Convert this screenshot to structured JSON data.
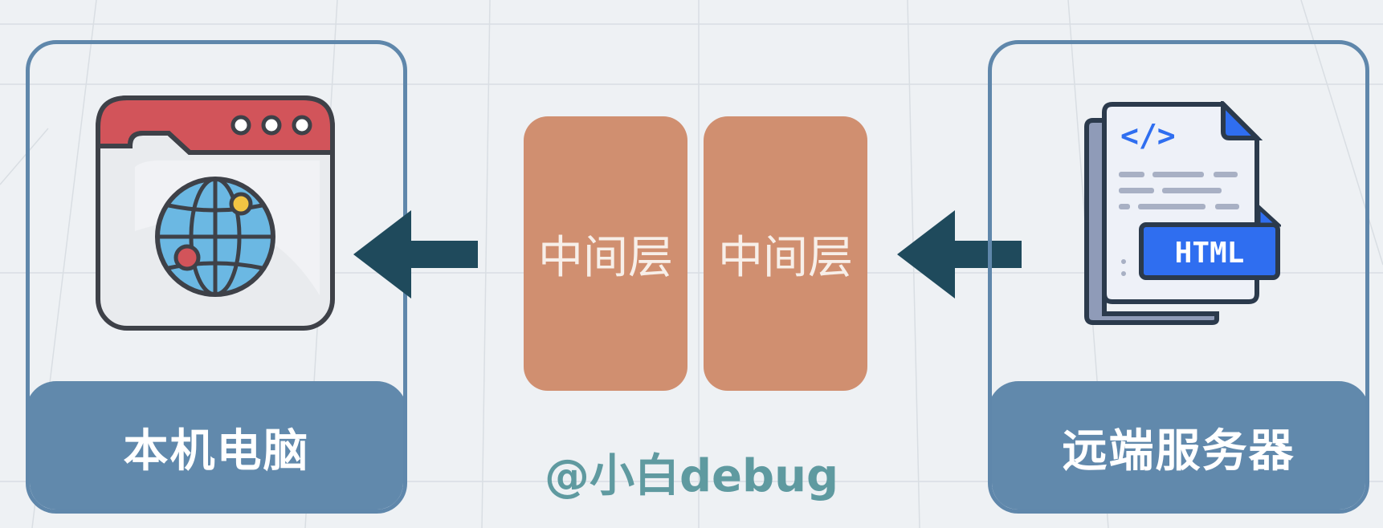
{
  "local_computer": {
    "label": "本机电脑",
    "icon": "browser-globe-icon"
  },
  "middle_layers": [
    {
      "label": "中间层"
    },
    {
      "label": "中间层"
    }
  ],
  "remote_server": {
    "label": "远端服务器",
    "icon": "html-file-icon",
    "code_tag": "</>",
    "badge_text": "HTML"
  },
  "watermark": "@小白debug",
  "colors": {
    "panel_border": "#5f87ab",
    "panel_footer": "#6189ac",
    "middle_box": "#d08f70",
    "arrow": "#1f4a5c",
    "watermark": "#5f9aa0",
    "background": "#eef1f4"
  }
}
